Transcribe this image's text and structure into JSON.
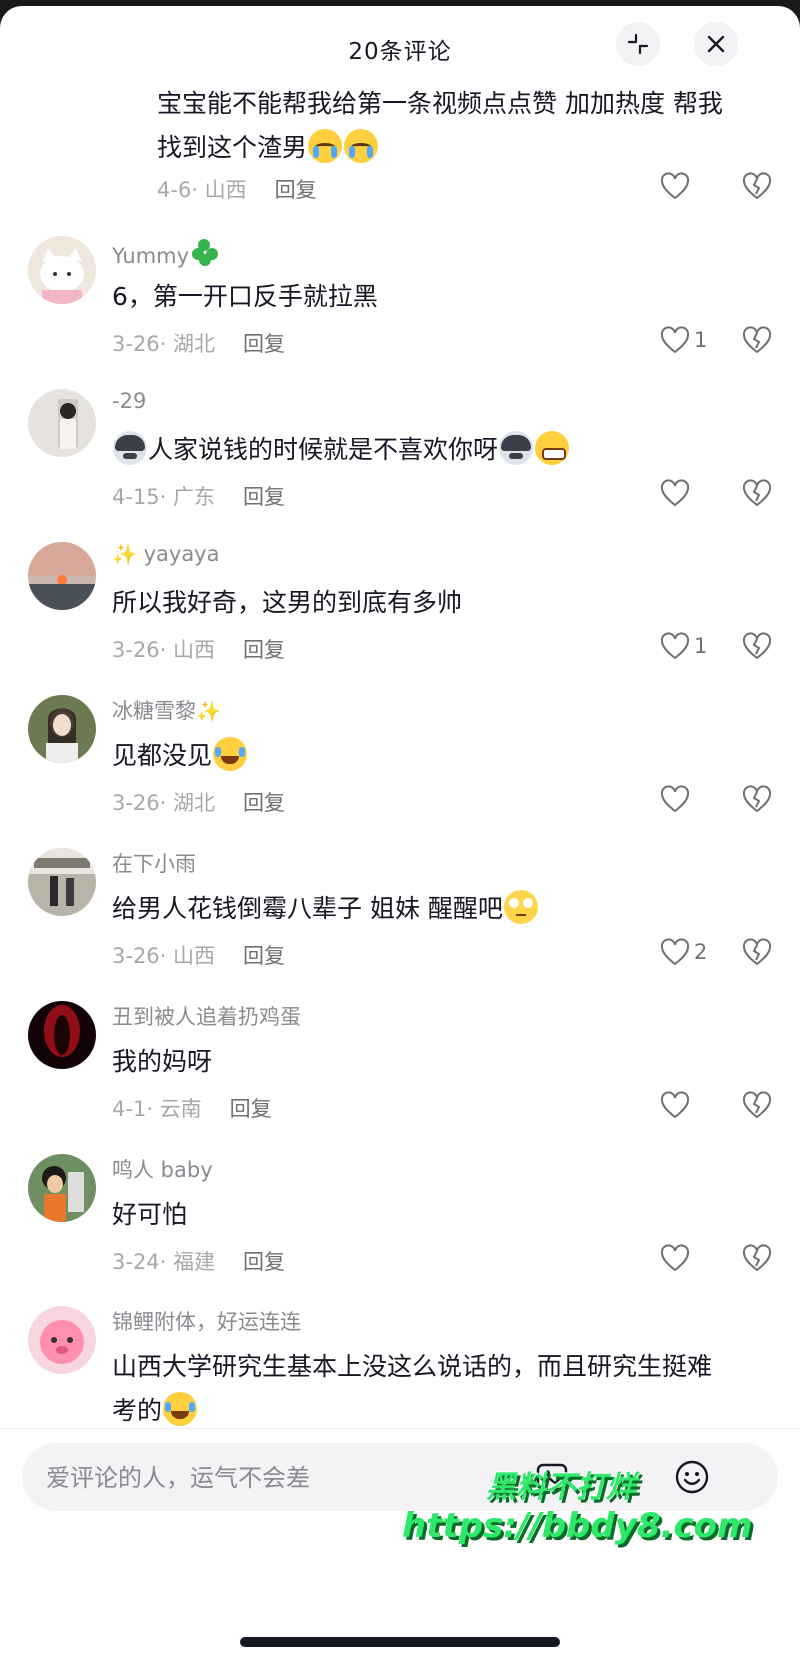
{
  "header": {
    "title": "20条评论"
  },
  "comments": [
    {
      "username": "",
      "text_parts": [
        "宝宝能不能帮我给第一条视频点点赞 加加热度 帮我找到这个渣男"
      ],
      "emojis_end": [
        "cry",
        "cry"
      ],
      "date": "4-6",
      "location": "山西",
      "reply_label": "回复",
      "likes": ""
    },
    {
      "username": "Yummy",
      "name_emoji": "clover",
      "text_parts": [
        "6，第一开口反手就拉黑"
      ],
      "date": "3-26",
      "location": "湖北",
      "reply_label": "回复",
      "likes": "1"
    },
    {
      "username": "-29",
      "text_parts": [
        "人家说钱的时候就是不喜欢你呀"
      ],
      "date": "4-15",
      "location": "广东",
      "reply_label": "回复",
      "likes": ""
    },
    {
      "username": "yayaya",
      "name_prefix": "✨",
      "text_parts": [
        "所以我好奇，这男的到底有多帅"
      ],
      "date": "3-26",
      "location": "山西",
      "reply_label": "回复",
      "likes": "1"
    },
    {
      "username": "冰糖雪黎",
      "name_suffix": "✨",
      "text_parts": [
        "见都没见"
      ],
      "date": "3-26",
      "location": "湖北",
      "reply_label": "回复",
      "likes": ""
    },
    {
      "username": "在下小雨",
      "text_parts": [
        "给男人花钱倒霉八辈子 姐妹 醒醒吧"
      ],
      "date": "3-26",
      "location": "山西",
      "reply_label": "回复",
      "likes": "2"
    },
    {
      "username": "丑到被人追着扔鸡蛋",
      "text_parts": [
        "我的妈呀"
      ],
      "date": "4-1",
      "location": "云南",
      "reply_label": "回复",
      "likes": ""
    },
    {
      "username": "鸣人 baby",
      "text_parts": [
        "好可怕"
      ],
      "date": "3-24",
      "location": "福建",
      "reply_label": "回复",
      "likes": ""
    },
    {
      "username": "锦鲤附体，好运连连",
      "text_parts": [
        "山西大学研究生基本上没这么说话的，而且研究生挺难考的"
      ],
      "date": "",
      "location": "",
      "reply_label": "",
      "likes": ""
    }
  ],
  "composer": {
    "placeholder": "爱评论的人，运气不会差"
  },
  "watermark": {
    "line1": "黑料不打烊",
    "line2": "https://bbdy8.com"
  },
  "icons": {
    "header_collapse": "collapse-icon",
    "header_close": "close-icon",
    "like": "heart-icon",
    "dislike": "broken-heart-icon",
    "image": "image-icon",
    "emoji": "emoji-icon"
  },
  "colors": {
    "text": "#161823",
    "meta": "#a7a8ad",
    "watermark": "#2ee86a"
  }
}
